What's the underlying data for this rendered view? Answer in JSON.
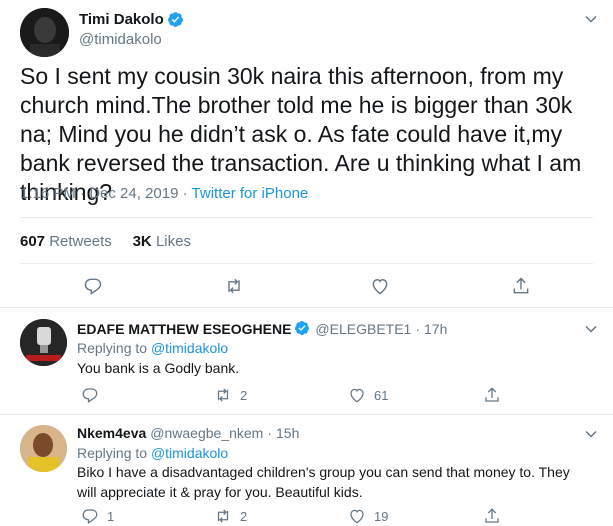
{
  "main_tweet": {
    "author_name": "Timi Dakolo",
    "author_handle": "@timidakolo",
    "text": "So I sent  my cousin 30k naira this afternoon, from my church mind.The brother told me he is bigger than 30k na; Mind you he didn’t ask o. As fate could have it,my bank reversed the transaction. Are u thinking what I am thinking?",
    "time": "1:16 PM",
    "separator": "·",
    "date": "Dec 24, 2019",
    "source": "Twitter for iPhone",
    "retweets_count": "607",
    "retweets_label": "Retweets",
    "likes_count": "3K",
    "likes_label": "Likes"
  },
  "replies": [
    {
      "author_name": "EDAFE MATTHEW ESEOGHENE",
      "author_handle": "@ELEGBETE1",
      "dot": "·",
      "time": "17h",
      "replying_label": "Replying to",
      "replying_to": "@timidakolo",
      "text": "You bank is a Godly bank.",
      "reply_count": "",
      "retweet_count": "2",
      "like_count": "61"
    },
    {
      "author_name": "Nkem4eva",
      "author_handle": "@nwaegbe_nkem",
      "dot": "·",
      "time": "15h",
      "replying_label": "Replying to",
      "replying_to": "@timidakolo",
      "text": "Biko I have a disadvantaged children's group you can send that money to. They will appreciate it & pray for you. Beautiful kids.",
      "reply_count": "1",
      "retweet_count": "2",
      "like_count": "19"
    }
  ],
  "icons": {
    "reply": "reply-icon",
    "retweet": "retweet-icon",
    "like": "heart-icon",
    "share": "share-icon",
    "verified": "verified-badge-icon",
    "caret": "chevron-down-icon"
  },
  "colors": {
    "link": "#1b95e0",
    "muted": "#657786",
    "text": "#14171a",
    "verified": "#1da1f2",
    "border": "#e6ecf0"
  }
}
